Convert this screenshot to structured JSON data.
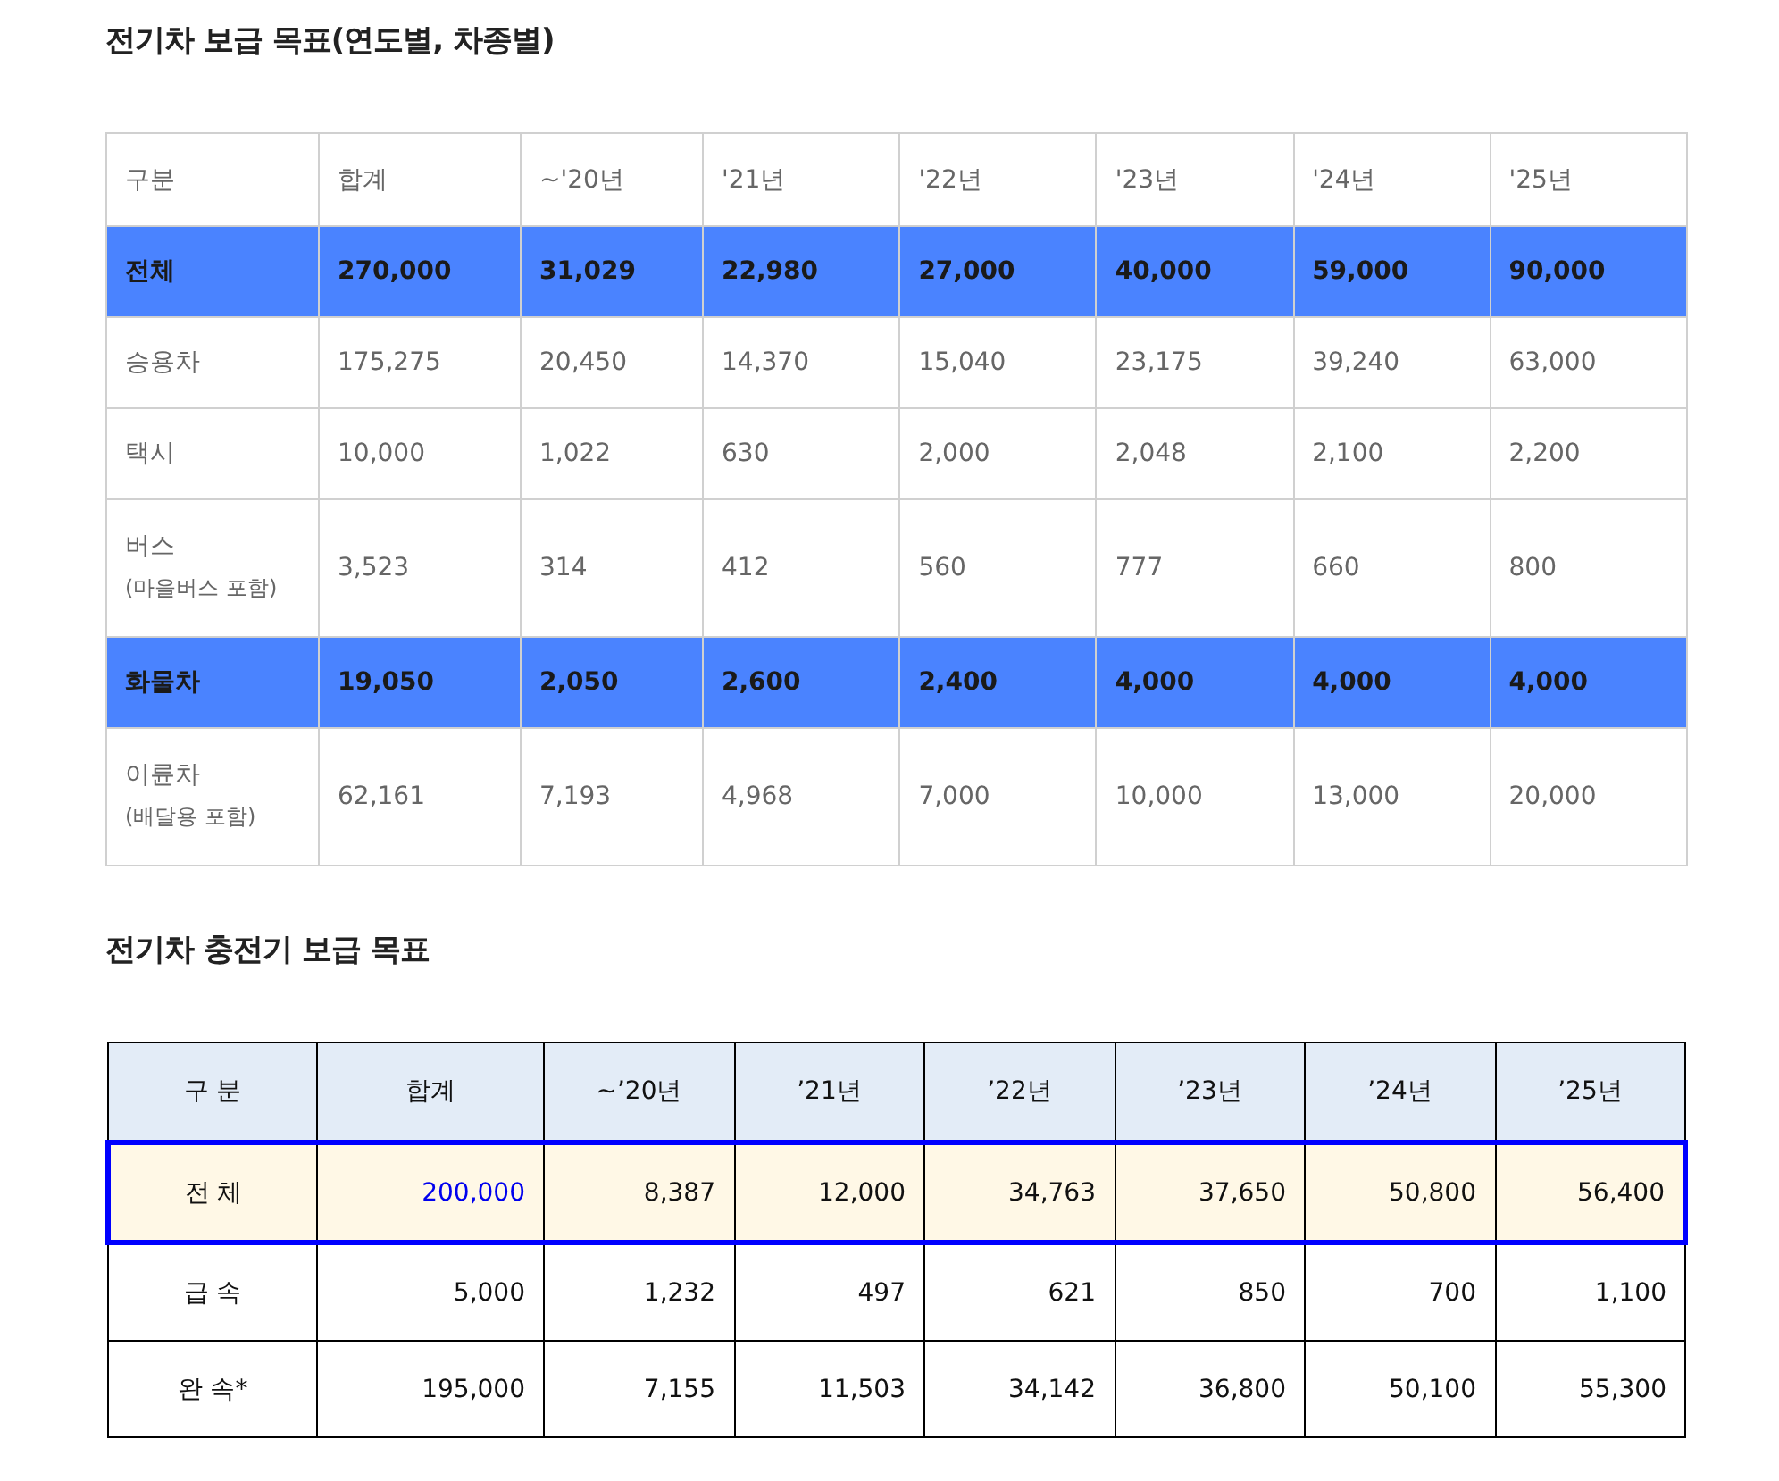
{
  "sections": [
    {
      "title": "전기차 보급 목표(연도별, 차종별)",
      "table": {
        "kind": "plain",
        "columns": [
          "구분",
          "합계",
          "~'20년",
          "'21년",
          "'22년",
          "'23년",
          "'24년",
          "'25년"
        ],
        "rows": [
          {
            "label": "전체",
            "highlighted": true,
            "values": [
              "270,000",
              "31,029",
              "22,980",
              "27,000",
              "40,000",
              "59,000",
              "90,000"
            ]
          },
          {
            "label": "승용차",
            "highlighted": false,
            "values": [
              "175,275",
              "20,450",
              "14,370",
              "15,040",
              "23,175",
              "39,240",
              "63,000"
            ]
          },
          {
            "label": "택시",
            "highlighted": false,
            "values": [
              "10,000",
              "1,022",
              "630",
              "2,000",
              "2,048",
              "2,100",
              "2,200"
            ]
          },
          {
            "label": "버스",
            "note": "(마을버스 포함)",
            "highlighted": false,
            "values": [
              "3,523",
              "314",
              "412",
              "560",
              "777",
              "660",
              "800"
            ]
          },
          {
            "label": "화물차",
            "highlighted": true,
            "values": [
              "19,050",
              "2,050",
              "2,600",
              "2,400",
              "4,000",
              "4,000",
              "4,000"
            ]
          },
          {
            "label": "이륜차",
            "note": "(배달용 포함)",
            "highlighted": false,
            "values": [
              "62,161",
              "7,193",
              "4,968",
              "7,000",
              "10,000",
              "13,000",
              "20,000"
            ]
          }
        ]
      }
    },
    {
      "title": "전기차 충전기 보급 목표",
      "table": {
        "kind": "boxed",
        "columns": [
          "구 분",
          "합계",
          "~’20년",
          "’21년",
          "’22년",
          "’23년",
          "’24년",
          "’25년"
        ],
        "rows": [
          {
            "label": "전 체",
            "highlighted": true,
            "values": [
              "200,000",
              "8,387",
              "12,000",
              "34,763",
              "37,650",
              "50,800",
              "56,400"
            ]
          },
          {
            "label": "급 속",
            "highlighted": false,
            "values": [
              "5,000",
              "1,232",
              "497",
              "621",
              "850",
              "700",
              "1,100"
            ]
          },
          {
            "label": "완 속*",
            "highlighted": false,
            "values": [
              "195,000",
              "7,155",
              "11,503",
              "34,142",
              "36,800",
              "50,100",
              "55,300"
            ]
          }
        ]
      }
    }
  ]
}
